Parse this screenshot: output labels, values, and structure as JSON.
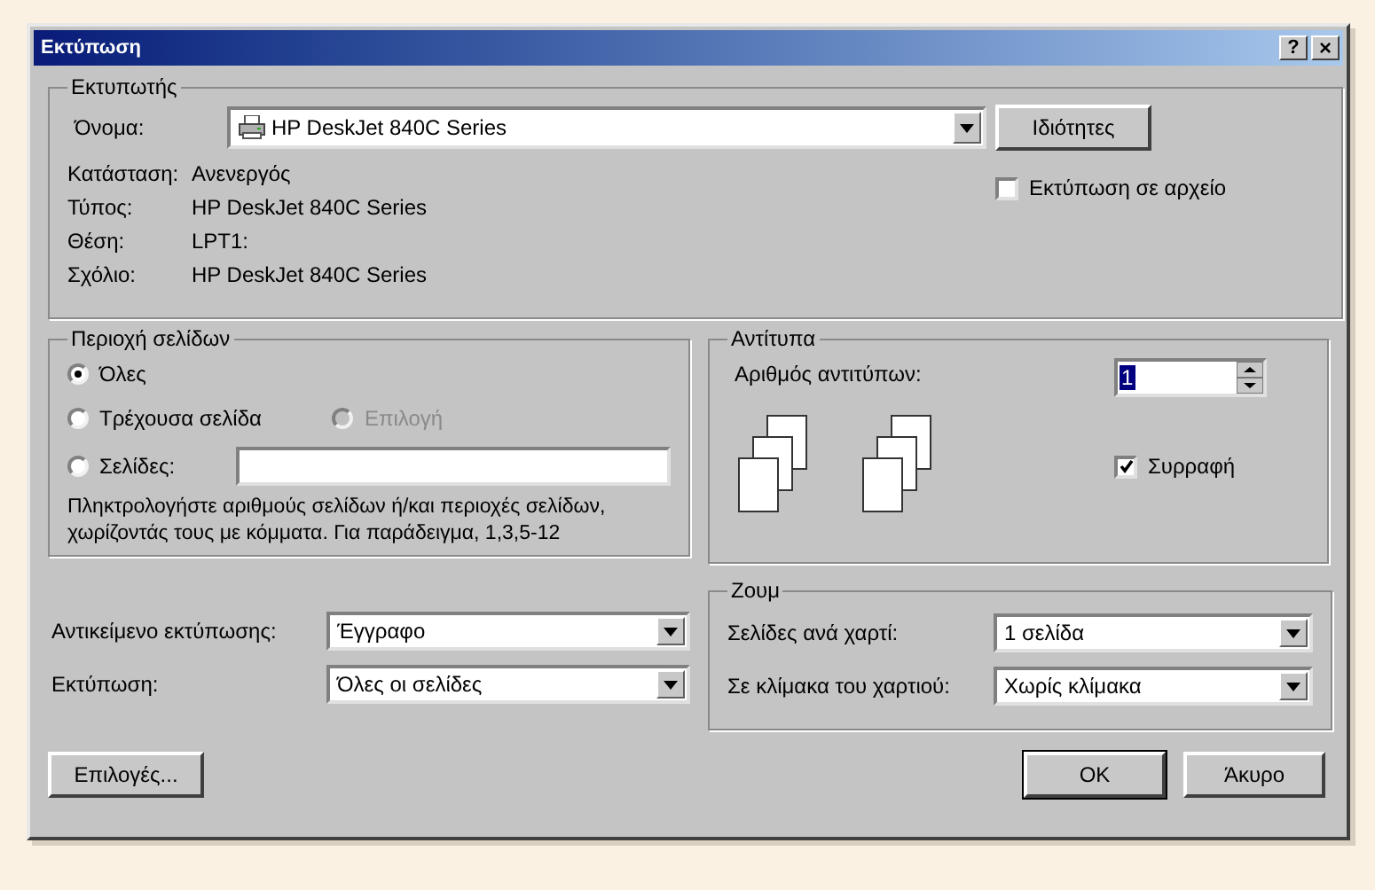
{
  "window": {
    "title": "Εκτύπωση",
    "help_button": "?",
    "close_button": "×"
  },
  "printer": {
    "title": "Εκτυπωτής",
    "name_label": "Όνομα:",
    "name_value": "HP DeskJet 840C Series",
    "properties_button": "Ιδιότητες",
    "details": [
      {
        "label": "Κατάσταση:",
        "value": "Ανενεργός"
      },
      {
        "label": "Τύπος:",
        "value": "HP DeskJet 840C Series"
      },
      {
        "label": "Θέση:",
        "value": "LPT1:"
      },
      {
        "label": "Σχόλιο:",
        "value": "HP DeskJet 840C Series"
      }
    ],
    "print_to_file": {
      "label": "Εκτύπωση σε αρχείο",
      "checked": false
    }
  },
  "page_range": {
    "title": "Περιοχή σελίδων",
    "options": [
      {
        "label": "Όλες",
        "selected": true,
        "disabled": false
      },
      {
        "label": "Τρέχουσα σελίδα",
        "selected": false,
        "disabled": false
      },
      {
        "label": "Επιλογή",
        "selected": false,
        "disabled": true
      },
      {
        "label": "Σελίδες:",
        "selected": false,
        "disabled": false
      }
    ],
    "hint": "Πληκτρολογήστε αριθμούς σελίδων ή/και περιοχές σελίδων, χωρίζοντάς τους με κόμματα. Για παράδειγμα, 1,3,5-12"
  },
  "copies": {
    "title": "Αντίτυπα",
    "label": "Αριθμός αντιτύπων:",
    "value": "1",
    "collate": {
      "label": "Συρραφή",
      "checked": true
    }
  },
  "print_what": [
    {
      "label": "Αντικείμενο εκτύπωσης:",
      "value": "Έγγραφο"
    },
    {
      "label": "Εκτύπωση:",
      "value": "Όλες οι σελίδες"
    }
  ],
  "zoom": {
    "title": "Ζουμ",
    "fields": [
      {
        "label": "Σελίδες ανά χαρτί:",
        "value": "1 σελίδα"
      },
      {
        "label": "Σε κλίμακα του χαρτιού:",
        "value": "Χωρίς κλίμακα"
      }
    ]
  },
  "buttons": {
    "options": "Επιλογές...",
    "ok": "OK",
    "cancel": "Άκυρο"
  }
}
